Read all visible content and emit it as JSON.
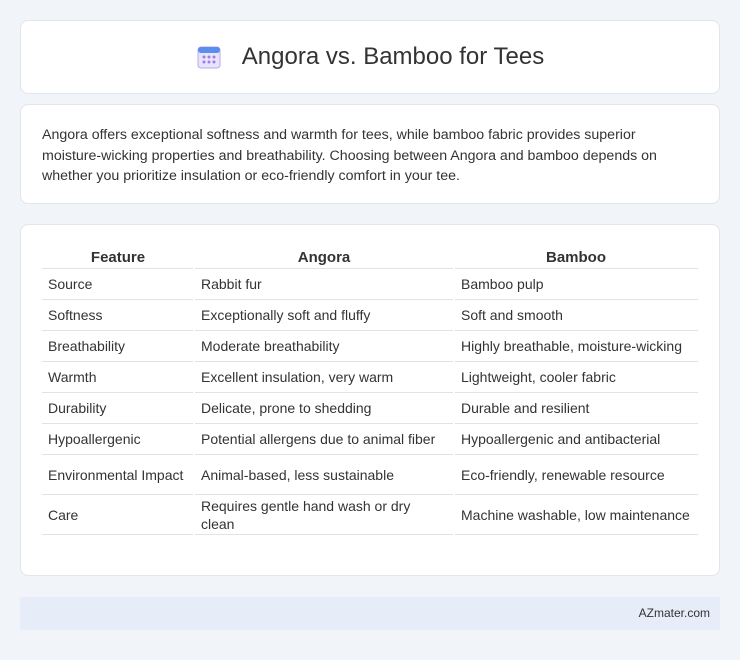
{
  "header": {
    "title": "Angora vs. Bamboo for Tees",
    "icon": "calendar-icon"
  },
  "intro": {
    "text": "Angora offers exceptional softness and warmth for tees, while bamboo fabric provides superior moisture-wicking properties and breathability. Choosing between Angora and bamboo depends on whether you prioritize insulation or eco-friendly comfort in your tee."
  },
  "table": {
    "headers": [
      "Feature",
      "Angora",
      "Bamboo"
    ],
    "rows": [
      [
        "Source",
        "Rabbit fur",
        "Bamboo pulp"
      ],
      [
        "Softness",
        "Exceptionally soft and fluffy",
        "Soft and smooth"
      ],
      [
        "Breathability",
        "Moderate breathability",
        "Highly breathable, moisture-wicking"
      ],
      [
        "Warmth",
        "Excellent insulation, very warm",
        "Lightweight, cooler fabric"
      ],
      [
        "Durability",
        "Delicate, prone to shedding",
        "Durable and resilient"
      ],
      [
        "Hypoallergenic",
        "Potential allergens due to animal fiber",
        "Hypoallergenic and antibacterial"
      ],
      [
        "Environmental Impact",
        "Animal-based, less sustainable",
        "Eco-friendly, renewable resource"
      ],
      [
        "Care",
        "Requires gentle hand wash or dry clean",
        "Machine washable, low maintenance"
      ]
    ]
  },
  "footer": {
    "text": "AZmater.com"
  }
}
